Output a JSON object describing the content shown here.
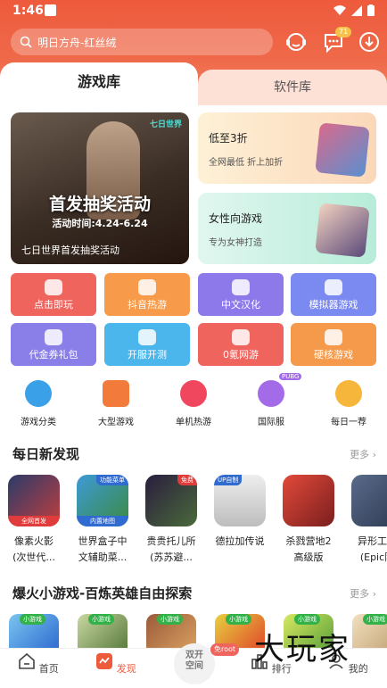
{
  "status": {
    "time": "1:46"
  },
  "search": {
    "placeholder": "明日方舟-红丝绒",
    "badge": "71"
  },
  "tabs": {
    "games": "游戏库",
    "software": "软件库"
  },
  "banner": {
    "logo": "七日世界",
    "title": "首发抽奖活动",
    "period": "活动时间:4.24-6.24",
    "caption": "七日世界首发抽奖活动"
  },
  "promos": [
    {
      "title": "低至3折",
      "sub": "全网最低 折上加折"
    },
    {
      "title": "女性向游戏",
      "sub": "专为女神打造"
    }
  ],
  "categories": [
    {
      "label": "点击即玩",
      "color": "#f0645e"
    },
    {
      "label": "抖音热游",
      "color": "#f79a4a"
    },
    {
      "label": "中文汉化",
      "color": "#8d79ea"
    },
    {
      "label": "模拟器游戏",
      "color": "#7b8af0"
    },
    {
      "label": "代金券礼包",
      "color": "#8a7ee8"
    },
    {
      "label": "开服开测",
      "color": "#4ab6ec"
    },
    {
      "label": "0氪网游",
      "color": "#f0645e"
    },
    {
      "label": "硬核游戏",
      "color": "#f59a4a"
    }
  ],
  "features": [
    {
      "label": "游戏分类"
    },
    {
      "label": "大型游戏"
    },
    {
      "label": "单机热游"
    },
    {
      "label": "国际服",
      "tag": "PUBG"
    },
    {
      "label": "每日一荐"
    }
  ],
  "daily": {
    "title": "每日新发现",
    "more": "更多",
    "apps": [
      {
        "name1": "像素火影",
        "name2": "(次世代...",
        "tag": "全网首发"
      },
      {
        "name1": "世界盒子中",
        "name2": "文辅助菜...",
        "tag": "内置地图",
        "top": "功能菜单"
      },
      {
        "name1": "贵贵托儿所",
        "name2": "(苏苏避...",
        "top": "免费"
      },
      {
        "name1": "德拉加传说",
        "name2": "",
        "top": "UP自制"
      },
      {
        "name1": "杀戮营地2",
        "name2": "高级版"
      },
      {
        "name1": "异形工厂",
        "name2": "(Epic限"
      }
    ]
  },
  "mini": {
    "title": "爆火小游戏-百炼英雄自由探索",
    "more": "更多",
    "label": "小游戏"
  },
  "nav": {
    "home": "首页",
    "discover": "发现",
    "dual": "双开空间",
    "root": "免root",
    "rank": "排行",
    "mine": "我的"
  },
  "watermark": "大玩家"
}
